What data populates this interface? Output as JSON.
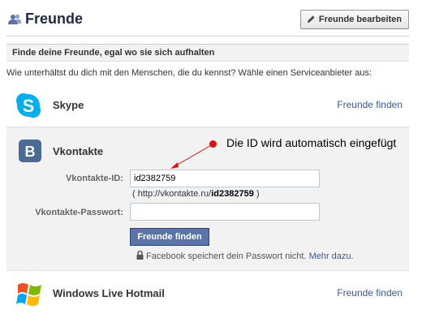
{
  "header": {
    "title": "Freunde",
    "edit_button": "Freunde bearbeiten"
  },
  "section": {
    "heading": "Finde deine Freunde, egal wo sie sich aufhalten",
    "intro": "Wie unterhältst du dich mit den Menschen, die du kennst? Wähle einen Serviceanbieter aus:"
  },
  "providers": {
    "skype": {
      "name": "Skype",
      "action": "Freunde finden",
      "color": "#00aff0"
    },
    "vkontakte": {
      "name": "Vkontakte",
      "color": "#4a6b94",
      "id_label": "Vkontakte-ID:",
      "id_value": "id2382759",
      "url_prefix": "( http://vkontakte.ru/",
      "url_id": "id2382759",
      "url_suffix": " )",
      "password_label": "Vkontakte-Passwort:",
      "password_value": "",
      "submit": "Freunde finden",
      "privacy_text": "Facebook speichert dein Passwort nicht.",
      "privacy_link": "Mehr dazu."
    },
    "hotmail": {
      "name": "Windows Live Hotmail",
      "action": "Freunde finden"
    }
  },
  "annotation": {
    "text": "Die ID wird automatisch eingefügt",
    "color": "#e01010"
  },
  "colors": {
    "link": "#3b5998",
    "button": "#5b74a8",
    "title": "#1c2a47"
  }
}
